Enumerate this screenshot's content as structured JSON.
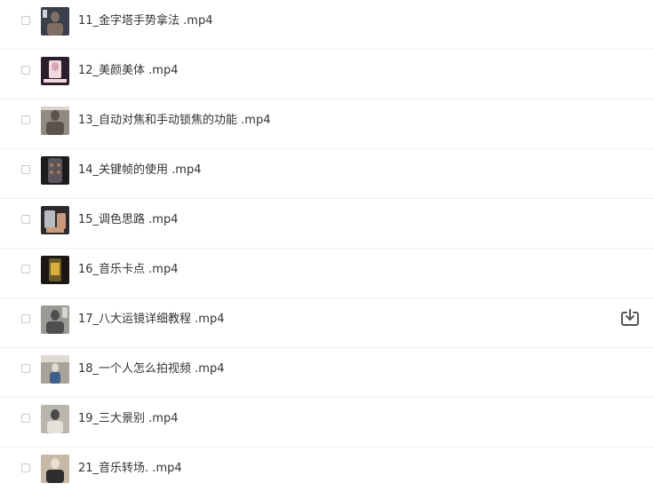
{
  "files": [
    {
      "name": "11_金字塔手势拿法 .mp4",
      "thumb": {
        "bg": "#3b3f4a",
        "accent": "#7f6e63",
        "light": "#cfd3d9"
      }
    },
    {
      "name": "12_美颜美体 .mp4",
      "thumb": {
        "bg": "#2a1f2b",
        "accent": "#d7a3b0",
        "light": "#f1d9e0"
      }
    },
    {
      "name": "13_自动对焦和手动锁焦的功能 .mp4",
      "thumb": {
        "bg": "#8f8a82",
        "accent": "#5d524a",
        "light": "#d9d4cc"
      }
    },
    {
      "name": "14_关键帧的使用 .mp4",
      "thumb": {
        "bg": "#1e1c1f",
        "accent": "#a07c5a",
        "light": "#59555a"
      }
    },
    {
      "name": "15_调色思路 .mp4",
      "thumb": {
        "bg": "#2c2a2c",
        "accent": "#c99a7c",
        "light": "#b8bcc2"
      }
    },
    {
      "name": "16_音乐卡点 .mp4",
      "thumb": {
        "bg": "#1a1712",
        "accent": "#d9b13a",
        "light": "#6b5a2a"
      }
    },
    {
      "name": "17_八大运镜详细教程 .mp4",
      "thumb": {
        "bg": "#9a9a96",
        "accent": "#4f4f4f",
        "light": "#d5d5d1"
      },
      "hover": true
    },
    {
      "name": "18_一个人怎么拍视频 .mp4",
      "thumb": {
        "bg": "#a8a39a",
        "accent": "#3e5f8a",
        "light": "#e0dbd2"
      }
    },
    {
      "name": "19_三大景别 .mp4",
      "thumb": {
        "bg": "#b8b6ad",
        "accent": "#4a4a4a",
        "light": "#e4e2db"
      }
    },
    {
      "name": "21_音乐转场. .mp4",
      "thumb": {
        "bg": "#c7b9a5",
        "accent": "#2d2d2d",
        "light": "#e9e0d2"
      }
    }
  ],
  "colors": {
    "text": "#333333",
    "divider": "#f0f0f0",
    "checkbox_border": "#c9c9c9",
    "download_icon": "#555555"
  }
}
